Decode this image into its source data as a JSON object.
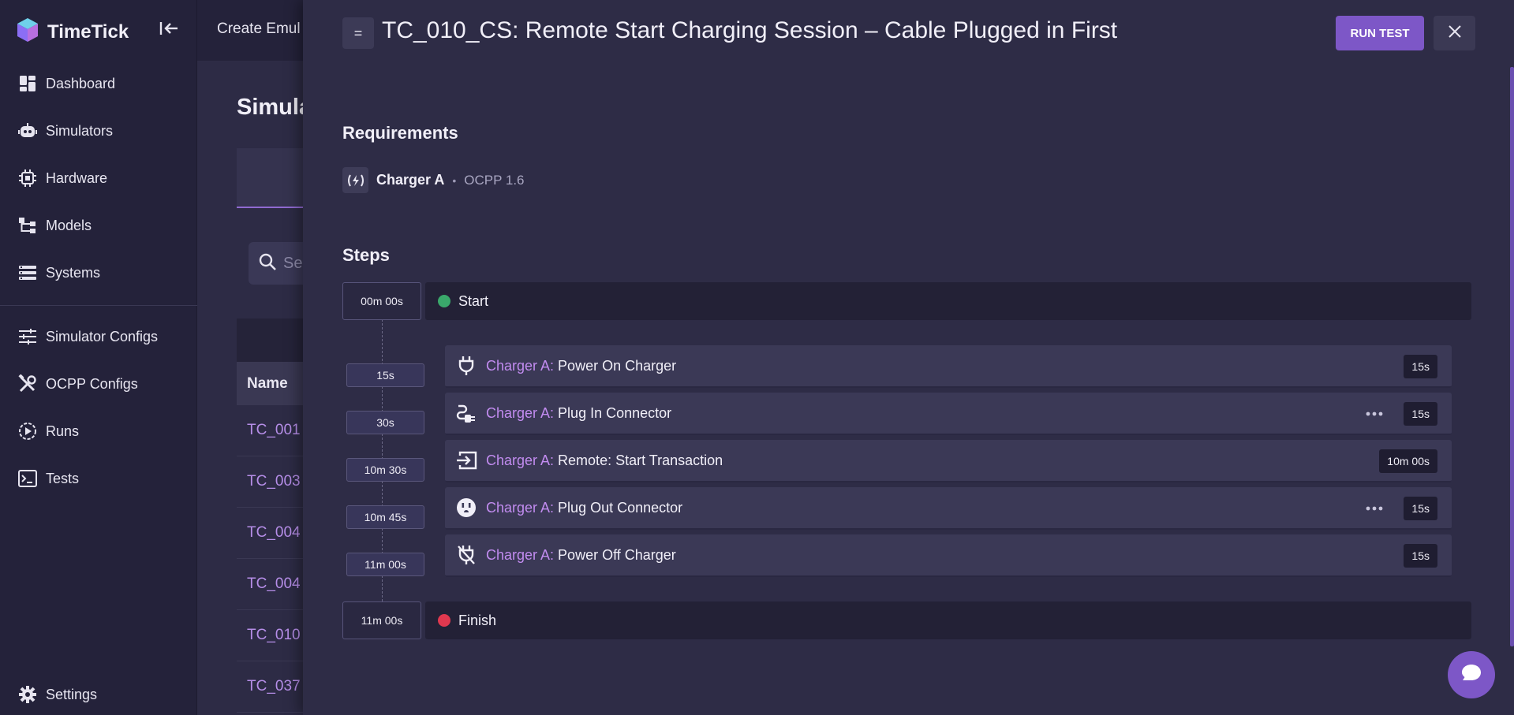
{
  "app": {
    "name": "TimeTick",
    "brand_color": "#7d57c7"
  },
  "topbar": {
    "title": "Create Emul"
  },
  "sidebar": {
    "items": [
      {
        "label": "Dashboard",
        "icon": "dashboard-icon"
      },
      {
        "label": "Simulators",
        "icon": "robot-icon"
      },
      {
        "label": "Hardware",
        "icon": "chip-icon"
      },
      {
        "label": "Models",
        "icon": "model-tree-icon"
      },
      {
        "label": "Systems",
        "icon": "list-icon"
      },
      {
        "label": "Simulator Configs",
        "icon": "sliders-icon"
      },
      {
        "label": "OCPP Configs",
        "icon": "tools-icon"
      },
      {
        "label": "Runs",
        "icon": "play-circle-icon"
      },
      {
        "label": "Tests",
        "icon": "terminal-icon"
      }
    ],
    "settings_label": "Settings"
  },
  "main": {
    "page_title": "Simula",
    "search_placeholder": "Se",
    "table": {
      "name_header": "Name",
      "rows": [
        "TC_001",
        "TC_003",
        "TC_004",
        "TC_004",
        "TC_010",
        "TC_037"
      ]
    }
  },
  "drawer": {
    "handle": "=",
    "title": "TC_010_CS: Remote Start Charging Session – Cable Plugged in First",
    "run_label": "RUN TEST",
    "requirements_title": "Requirements",
    "requirement": {
      "name": "Charger A",
      "separator": "•",
      "protocol": "OCPP 1.6"
    },
    "steps_title": "Steps",
    "start": {
      "time": "00m 00s",
      "label": "Start",
      "color": "#3aa86b"
    },
    "finish": {
      "time": "11m 00s",
      "label": "Finish",
      "color": "#e0384f"
    },
    "steps": [
      {
        "time": "15s",
        "actor": "Charger A:",
        "action": "Power On Charger",
        "duration": "15s",
        "icon": "plug-icon"
      },
      {
        "time": "30s",
        "actor": "Charger A:",
        "action": "Plug In Connector",
        "duration": "15s",
        "icon": "ev-plug-icon"
      },
      {
        "time": "10m 30s",
        "actor": "Charger A:",
        "action": "Remote: Start Transaction",
        "duration": "10m 00s",
        "icon": "login-arrow-icon"
      },
      {
        "time": "10m 45s",
        "actor": "Charger A:",
        "action": "Plug Out Connector",
        "duration": "15s",
        "icon": "outlet-icon"
      },
      {
        "time": "11m 00s",
        "actor": "Charger A:",
        "action": "Power Off Charger",
        "duration": "15s",
        "icon": "plug-off-icon"
      }
    ]
  }
}
